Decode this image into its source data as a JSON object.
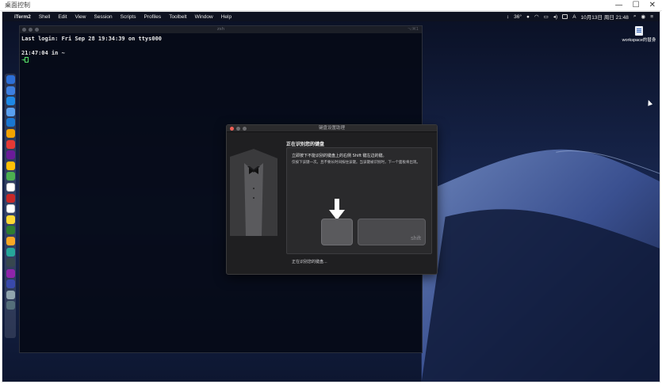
{
  "rdp": {
    "title": "桌面控制",
    "controls": [
      "—",
      "☐",
      "✕"
    ]
  },
  "menubar": {
    "app": "iTerm2",
    "items": [
      "Shell",
      "Edit",
      "View",
      "Session",
      "Scripts",
      "Profiles",
      "Toolbelt",
      "Window",
      "Help"
    ],
    "status": {
      "temp": "36°",
      "input_method": "A",
      "datetime": "10月13日 周日 21:48"
    }
  },
  "terminal": {
    "title": "zsh",
    "shortcut": "⌥⌘1",
    "lines": [
      "Last login: Fri Sep 28 19:34:39 on ttys000",
      "",
      "21:47:04 in ~"
    ],
    "prompt": "➜"
  },
  "desktop": {
    "icon_label": "workspace的替身"
  },
  "dialog": {
    "title": "键盘设置助理",
    "heading": "正在识别您的键盘",
    "instruction": "立即按下不能识别的键盘上的右侧 Shift 键左边的键。",
    "detail": "仅按下该键一次。且不要长时间按住该键。当该键被识别时，下一个面板将出现。",
    "key_label": "shift",
    "status": "正在识别您的键盘..."
  },
  "dock": {
    "colors": [
      "#2d6fd6",
      "#3d7fe0",
      "#1e88e5",
      "#5aa0f0",
      "#1976d2",
      "#f4a300",
      "#e53935",
      "#6a1b9a",
      "#ffc107",
      "#4caf50",
      "#ffffff",
      "#c62828",
      "#ffffff",
      "#fdd835",
      "#2e7d32",
      "#f9a825",
      "#26a69a",
      "#37474f",
      "#8e24aa",
      "#3949ab",
      "#90a4ae",
      "#546e7a"
    ]
  }
}
